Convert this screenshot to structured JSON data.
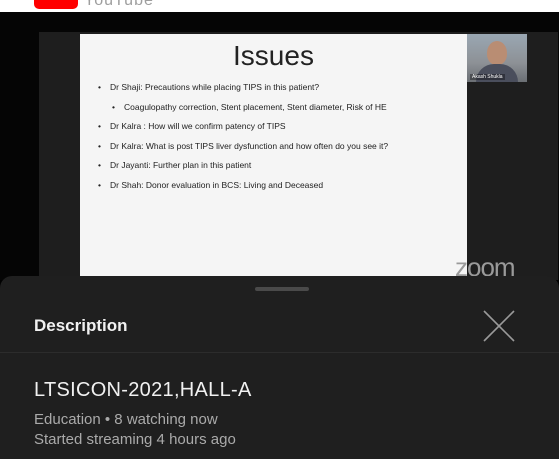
{
  "app": {
    "topbar_label": "YouTube",
    "logo_color": "#ff0000"
  },
  "slide": {
    "title": "Issues",
    "bullets": [
      {
        "text": "Dr  Shaji: Precautions while placing TIPS in this patient?",
        "level": 1
      },
      {
        "text": "Coagulopathy correction, Stent placement, Stent diameter, Risk of HE",
        "level": 2
      },
      {
        "text": "Dr Kalra : How will we confirm patency of TIPS",
        "level": 1
      },
      {
        "text": "Dr Kalra: What is post TIPS liver dysfunction and how often do you see it?",
        "level": 1
      },
      {
        "text": "Dr Jayanti: Further plan in this patient",
        "level": 1
      },
      {
        "text": "Dr Shah: Donor evaluation in BCS: Living and Deceased",
        "level": 1
      }
    ]
  },
  "speaker": {
    "name": "Akash Shukla"
  },
  "watermark": {
    "text": "zoom"
  },
  "description_panel": {
    "heading": "Description",
    "close_icon": "close-icon",
    "video_title": "LTSICON-2021,HALL-A",
    "meta_line1": "Education • 8 watching now",
    "meta_line2": "Started streaming 4 hours ago"
  },
  "colors": {
    "panel_background": "#1f1f1f",
    "primary_text": "#f1f1f1",
    "secondary_text": "#aaaaaa"
  }
}
